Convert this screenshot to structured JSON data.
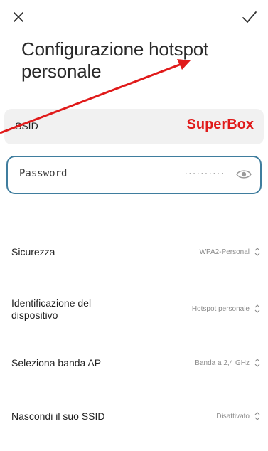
{
  "header": {
    "title": "Configurazione hotspot personale"
  },
  "ssid": {
    "label": "SSID",
    "value": "SuperBox"
  },
  "password": {
    "label": "Password",
    "value": "··········"
  },
  "settings": [
    {
      "label": "Sicurezza",
      "value": "WPA2-Personal"
    },
    {
      "label": "Identificazione del dispositivo",
      "value": "Hotspot personale"
    },
    {
      "label": "Seleziona banda AP",
      "value": "Banda a 2,4 GHz"
    },
    {
      "label": "Nascondi il suo SSID",
      "value": "Disattivato"
    }
  ],
  "icons": {
    "close": "close-icon",
    "confirm": "checkmark-icon",
    "visibility": "eye-icon",
    "selector": "up-down-chevron-icon"
  },
  "colors": {
    "annotation_red": "#e01a1a",
    "password_border": "#3f7d9e",
    "ssid_background": "#f1f1f1"
  }
}
